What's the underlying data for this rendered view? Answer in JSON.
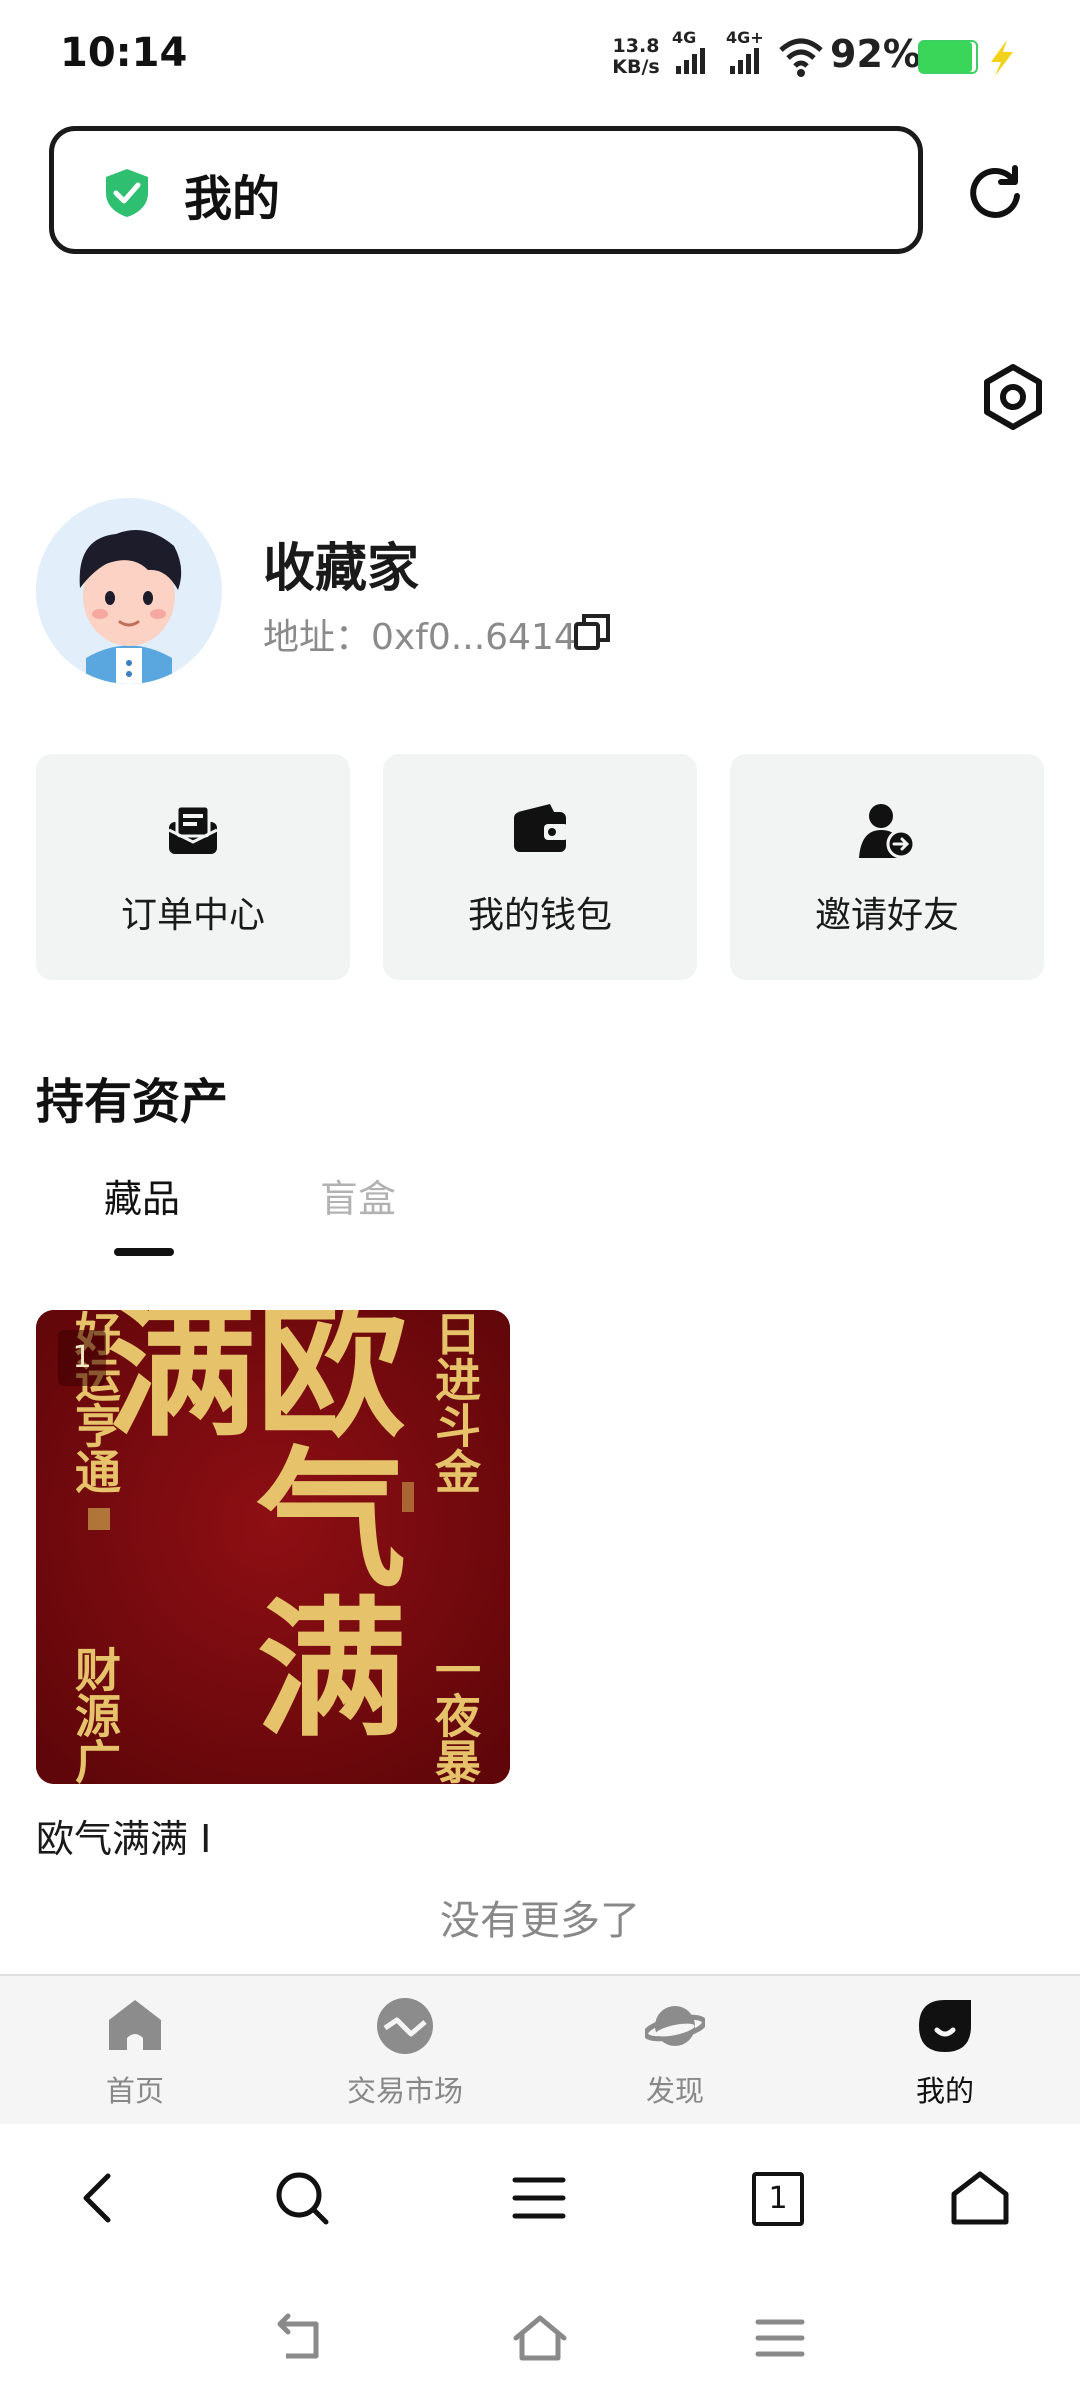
{
  "status_bar": {
    "time": "10:14",
    "net_speed_value": "13.8",
    "net_speed_unit": "KB/s",
    "signal_1": "4G",
    "signal_2": "4G+",
    "battery": "92%"
  },
  "browser": {
    "address_title": "我的"
  },
  "profile": {
    "nickname": "收藏家",
    "address_label": "地址：",
    "address_value": "0xf0...6414"
  },
  "quick_actions": [
    {
      "label": "订单中心",
      "icon": "order-icon"
    },
    {
      "label": "我的钱包",
      "icon": "wallet-icon"
    },
    {
      "label": "邀请好友",
      "icon": "invite-user-icon"
    }
  ],
  "assets": {
    "title": "持有资产",
    "tabs": [
      {
        "label": "藏品",
        "active": true
      },
      {
        "label": "盲盒",
        "active": false
      }
    ],
    "items": [
      {
        "name": "欧气满满 I",
        "badge": "1",
        "main_text": "欧气满满",
        "left_text": "好运亨通",
        "right_text": "日进斗金",
        "left_bottom_text": "财源广",
        "right_bottom_text": "一夜暴"
      }
    ],
    "end_text": "没有更多了"
  },
  "app_nav": [
    {
      "label": "首页",
      "icon": "home-icon",
      "active": false
    },
    {
      "label": "交易市场",
      "icon": "market-icon",
      "active": false
    },
    {
      "label": "发现",
      "icon": "planet-icon",
      "active": false
    },
    {
      "label": "我的",
      "icon": "profile-icon",
      "active": true
    }
  ],
  "browser_toolbar": {
    "tab_count": "1"
  },
  "colors": {
    "accent_green": "#2fbf71",
    "nft_red": "#7a0b0f",
    "nft_gold": "#e6c36a"
  }
}
